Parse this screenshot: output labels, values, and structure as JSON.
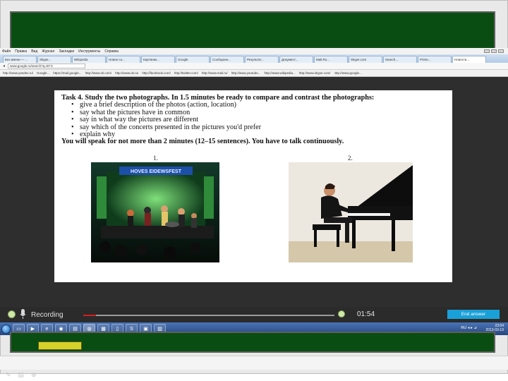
{
  "browser": {
    "menu_items": [
      "Файл",
      "Правка",
      "Вид",
      "Журнал",
      "Закладки",
      "Инструменты",
      "Справка"
    ],
    "tabs": [
      "Без имени — ...",
      "Skype...",
      "Wikipedia",
      "Новое со...",
      "Картинки...",
      "Google",
      "Сообщени...",
      "Результат...",
      "Документ...",
      "Mail.Ru...",
      "Skype.com",
      "Search...",
      "Prime...",
      "Новости...",
      "Погода...",
      "Фото..."
    ],
    "address": "www.google.ru/search?q=ЕГЭ",
    "bookmarks": [
      "http://www.yandex.ru/",
      "Google...",
      "https://mail.google...",
      "http://www.vk.com/",
      "http://www.ok.ru/",
      "http://facebook.com/",
      "http://twitter.com/",
      "http://www.mail.ru/",
      "http://www.youtube...",
      "http://www.wikipedia...",
      "http://www.skype.com/",
      "http://www.google...",
      "http://www.ozon.ru/",
      "http://www.rbc.ru/..."
    ]
  },
  "task": {
    "title": "Task 4. Study the two photographs. In 1.5 minutes be ready to compare and contrast the photographs:",
    "bullets": [
      "give a brief description of the photos (action, location)",
      "say what the pictures have in common",
      "say in what way the pictures are different",
      "say which of the concerts presented in the pictures you'd prefer",
      "explain why"
    ],
    "footer": "You will speak for not more than 2 minutes (12–15 sentences). You have to talk continuously.",
    "photo1_number": "1.",
    "photo2_number": "2.",
    "photo1_banner": "HOVES EIDEWSFEST"
  },
  "recorder": {
    "label": "Recording",
    "time": "01:54",
    "end_button": "End answer",
    "progress": 0.05
  },
  "taskbar": {
    "tray_icons": "RU ◂ ▸ ⊿",
    "time": "23:04",
    "date": "2013-03-19"
  },
  "colors": {
    "board": "#0a4d12",
    "accent_button": "#1aa0d8",
    "progress": "#d32020"
  }
}
